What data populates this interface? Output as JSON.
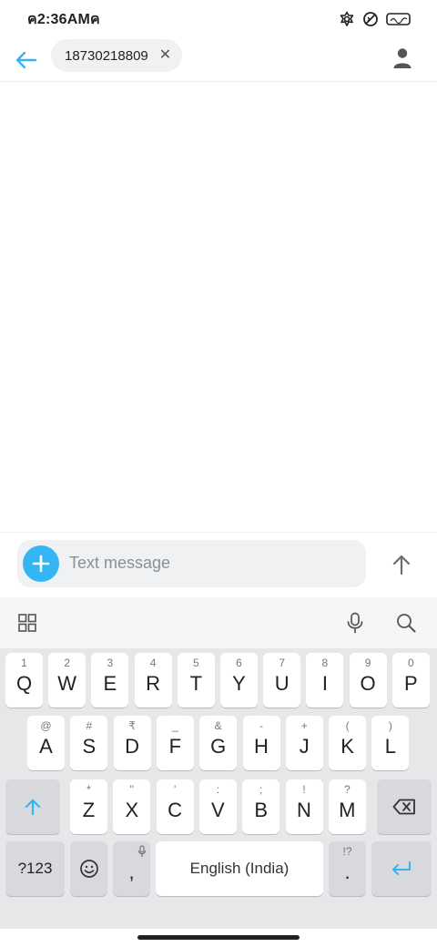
{
  "status_bar": {
    "time": "ค2:36AMค",
    "icons": [
      "flower-icon",
      "no-disturb-icon",
      "battery-icon"
    ]
  },
  "header": {
    "back_icon": "arrow-left-icon",
    "recipient": "18730218809",
    "chip_close": "✕",
    "profile_icon": "person-icon"
  },
  "compose": {
    "placeholder": "Text message",
    "add_icon": "plus-icon",
    "send_icon": "arrow-up-icon"
  },
  "keyboard": {
    "toolbar_icons": [
      "apps-grid-icon",
      "microphone-icon",
      "search-icon"
    ],
    "row1": [
      {
        "key": "Q",
        "hint": "1"
      },
      {
        "key": "W",
        "hint": "2"
      },
      {
        "key": "E",
        "hint": "3"
      },
      {
        "key": "R",
        "hint": "4"
      },
      {
        "key": "T",
        "hint": "5"
      },
      {
        "key": "Y",
        "hint": "6"
      },
      {
        "key": "U",
        "hint": "7"
      },
      {
        "key": "I",
        "hint": "8"
      },
      {
        "key": "O",
        "hint": "9"
      },
      {
        "key": "P",
        "hint": "0"
      }
    ],
    "row2": [
      {
        "key": "A",
        "hint": "@"
      },
      {
        "key": "S",
        "hint": "#"
      },
      {
        "key": "D",
        "hint": "₹"
      },
      {
        "key": "F",
        "hint": "_"
      },
      {
        "key": "G",
        "hint": "&"
      },
      {
        "key": "H",
        "hint": "-"
      },
      {
        "key": "J",
        "hint": "+"
      },
      {
        "key": "K",
        "hint": "("
      },
      {
        "key": "L",
        "hint": ")"
      }
    ],
    "row3": [
      {
        "key": "Z",
        "hint": "*"
      },
      {
        "key": "X",
        "hint": "\""
      },
      {
        "key": "C",
        "hint": "'"
      },
      {
        "key": "V",
        "hint": ":"
      },
      {
        "key": "B",
        "hint": ";"
      },
      {
        "key": "N",
        "hint": "!"
      },
      {
        "key": "M",
        "hint": "?"
      }
    ],
    "symbols_label": "?123",
    "comma": ",",
    "period": ".",
    "period_hint": "!?",
    "space_label": "English (India)",
    "accent_color": "#34b6f5"
  }
}
